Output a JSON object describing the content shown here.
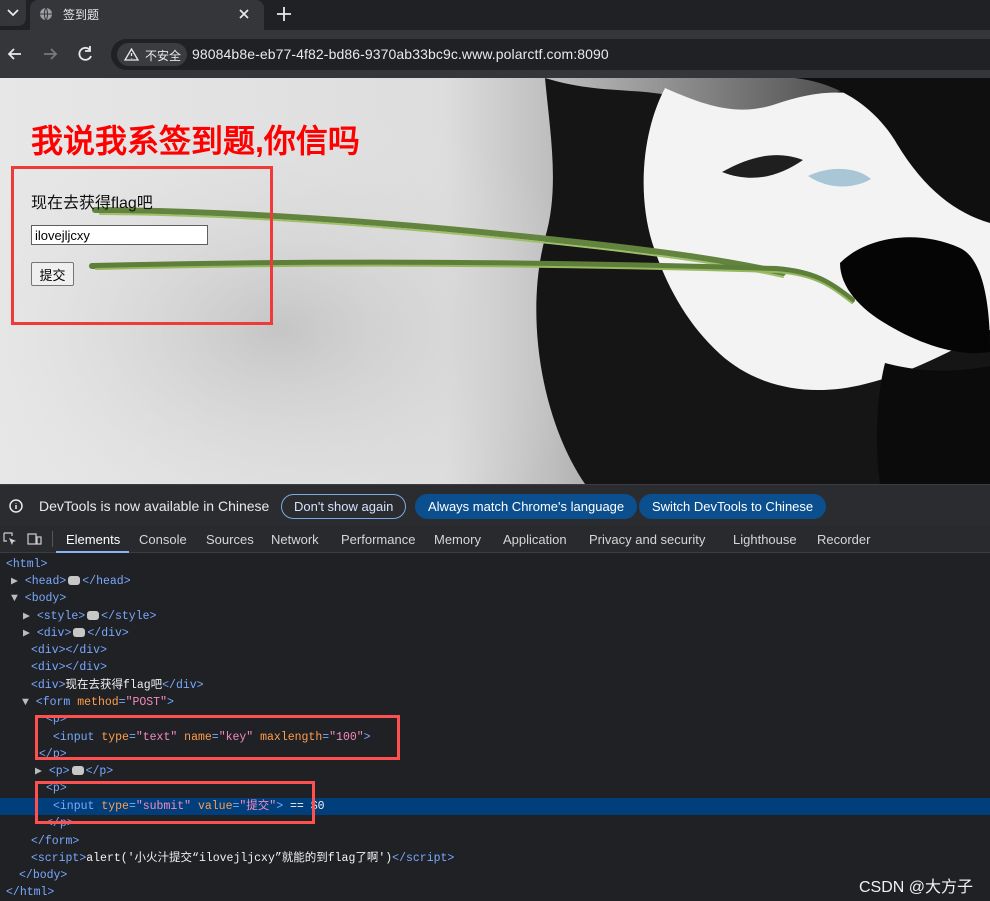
{
  "browser": {
    "tab_title": "签到题",
    "security_label": "不安全",
    "url": "98084b8e-eb77-4f82-bd86-9370ab33bc9c.www.polarctf.com:8090"
  },
  "page": {
    "heading": "我说我系签到题,你信吗",
    "prompt": "现在去获得flag吧",
    "key_value": "ilovejljcxy",
    "submit_label": "提交"
  },
  "devtools": {
    "infobar": {
      "text": "DevTools is now available in Chinese",
      "dont_show": "Don't show again",
      "match_language": "Always match Chrome's language",
      "switch_language": "Switch DevTools to Chinese"
    },
    "tabs": [
      "Elements",
      "Console",
      "Sources",
      "Network",
      "Performance",
      "Memory",
      "Application",
      "Privacy and security",
      "Lighthouse",
      "Recorder"
    ],
    "dom": {
      "html": "html",
      "head": "head",
      "body": "body",
      "style": "style",
      "div": "div",
      "div_text": "现在去获得flag吧",
      "form": "form",
      "method_attr": "method",
      "method_value": "\"POST\"",
      "p": "p",
      "input": "input",
      "type_attr": "type",
      "name_attr": "name",
      "maxlength_attr": "maxlength",
      "value_attr": "value",
      "text_value": "\"text\"",
      "key_value": "\"key\"",
      "maxlength_value": "\"100\"",
      "submit_value": "\"submit\"",
      "button_value": "\"提交\"",
      "dom_marker": " == $0",
      "script": "script",
      "script_text": "alert('小火汁提交“ilovejljcxy”就能的到flag了啊')"
    },
    "watermark": "CSDN @大方子"
  }
}
